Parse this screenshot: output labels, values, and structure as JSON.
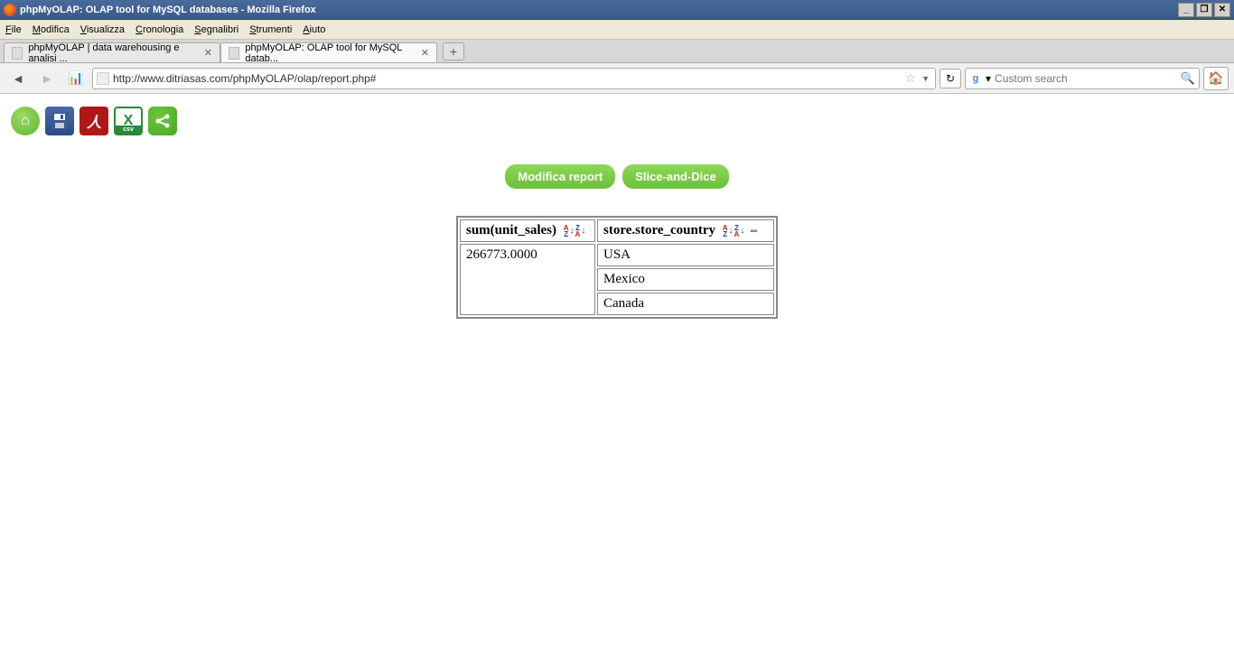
{
  "window": {
    "title": "phpMyOLAP: OLAP tool for MySQL databases - Mozilla Firefox"
  },
  "menu": {
    "items": [
      "File",
      "Modifica",
      "Visualizza",
      "Cronologia",
      "Segnalibri",
      "Strumenti",
      "Aiuto"
    ]
  },
  "tabs": [
    {
      "label": "phpMyOLAP | data warehousing e analisi ...",
      "active": false
    },
    {
      "label": "phpMyOLAP: OLAP tool for MySQL datab...",
      "active": true
    }
  ],
  "url": "http://www.ditriasas.com/phpMyOLAP/olap/report.php#",
  "search": {
    "placeholder": "Custom search"
  },
  "toolbar_icons": {
    "home": "⌂",
    "save": "💾",
    "pdf": "人",
    "excel": "X",
    "share": "<"
  },
  "actions": {
    "modify": "Modifica report",
    "slice": "Slice-and-Dice"
  },
  "table": {
    "col1_header": "sum(unit_sales)",
    "col2_header": "store.store_country",
    "value": "266773.0000",
    "rows": [
      "USA",
      "Mexico",
      "Canada"
    ]
  }
}
